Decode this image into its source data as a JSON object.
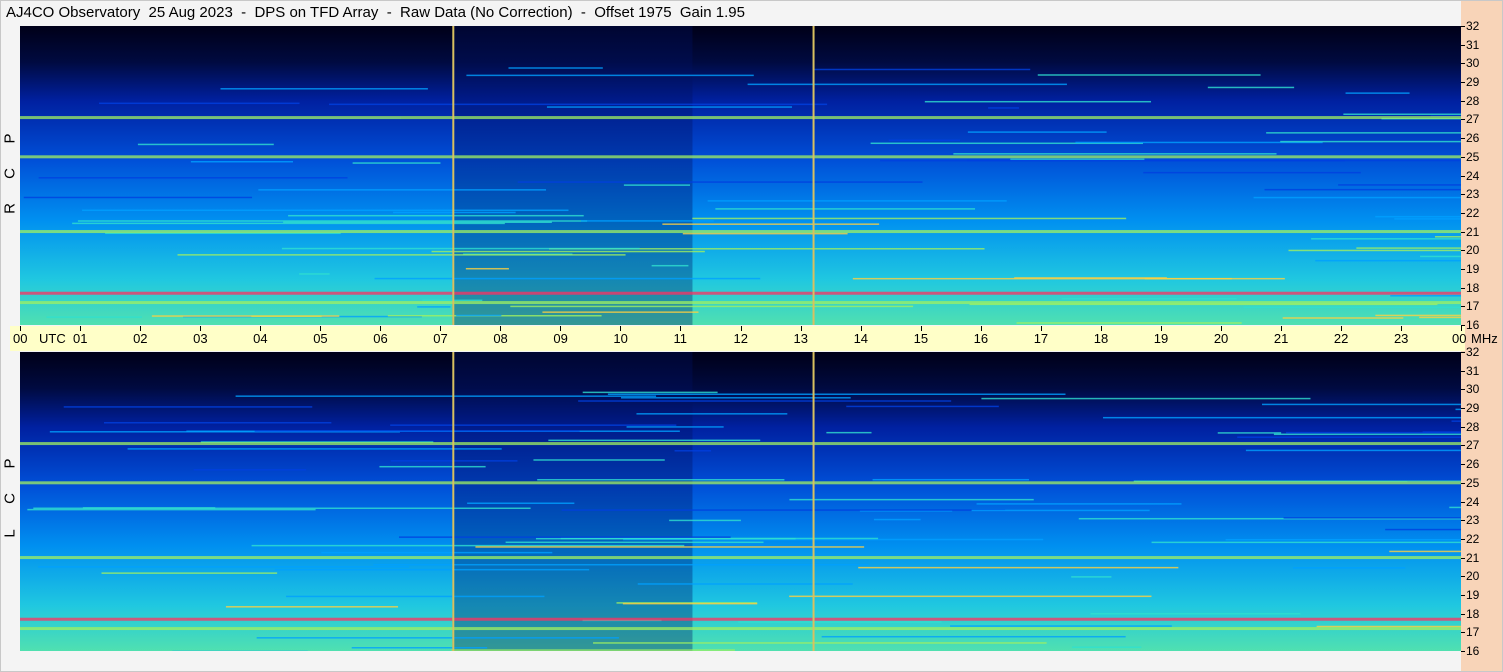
{
  "title": "AJ4CO Observatory  25 Aug 2023  -  DPS on TFD Array  -  Raw Data (No Correction)  -  Offset 1975  Gain 1.95",
  "panels": [
    {
      "id": "rcp",
      "label_letters": [
        "R",
        "C",
        "P"
      ]
    },
    {
      "id": "lcp",
      "label_letters": [
        "L",
        "C",
        "P"
      ]
    }
  ],
  "chart_data": {
    "type": "heatmap",
    "title": "AJ4CO Observatory  25 Aug 2023  -  DPS on TFD Array  -  Raw Data (No Correction)  -  Offset 1975  Gain 1.95",
    "x_axis": {
      "unit_label": "UTC",
      "ticks": [
        "00",
        "01",
        "02",
        "03",
        "04",
        "05",
        "06",
        "07",
        "08",
        "09",
        "10",
        "11",
        "12",
        "13",
        "14",
        "15",
        "16",
        "17",
        "18",
        "19",
        "20",
        "21",
        "22",
        "23",
        "00"
      ],
      "range": [
        0,
        24
      ]
    },
    "y_axis": {
      "unit_label": "MHz",
      "ticks": [
        16,
        17,
        18,
        19,
        20,
        21,
        22,
        23,
        24,
        25,
        26,
        27,
        28,
        29,
        30,
        31,
        32
      ],
      "range": [
        16,
        32
      ]
    },
    "series": [
      {
        "name": "RCP"
      },
      {
        "name": "LCP"
      }
    ],
    "colormap": [
      "#000020",
      "#001a8c",
      "#0040e0",
      "#00a0ff",
      "#30e0d0",
      "#a0f060",
      "#ffd040",
      "#ff3060"
    ],
    "vertical_markers_utc": [
      7.2,
      13.2
    ],
    "strong_bands_mhz": [
      27.1,
      25.0,
      21.0,
      17.7,
      17.2
    ]
  }
}
